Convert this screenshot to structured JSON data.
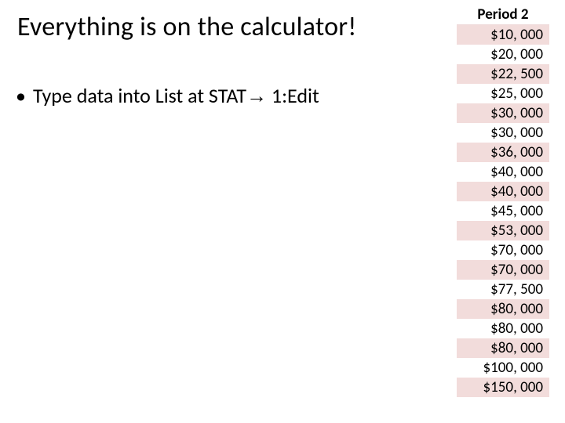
{
  "title": "Everything is on the calculator!",
  "bullet": {
    "prefix": "Type data into List at STAT",
    "arrow": "→",
    "suffix": " 1:Edit"
  },
  "table": {
    "header": "Period 2",
    "rows": [
      "$10, 000",
      "$20, 000",
      "$22, 500",
      "$25, 000",
      "$30, 000",
      "$30, 000",
      "$36, 000",
      "$40, 000",
      "$40, 000",
      "$45, 000",
      "$53, 000",
      "$70, 000",
      "$70, 000",
      "$77, 500",
      "$80, 000",
      "$80, 000",
      "$80, 000",
      "$100, 000",
      "$150, 000"
    ]
  },
  "chart_data": {
    "type": "table",
    "title": "Period 2",
    "categories": [
      "Period 2"
    ],
    "values": [
      10000,
      20000,
      22500,
      25000,
      30000,
      30000,
      36000,
      40000,
      40000,
      45000,
      53000,
      70000,
      70000,
      77500,
      80000,
      80000,
      80000,
      100000,
      150000
    ]
  }
}
